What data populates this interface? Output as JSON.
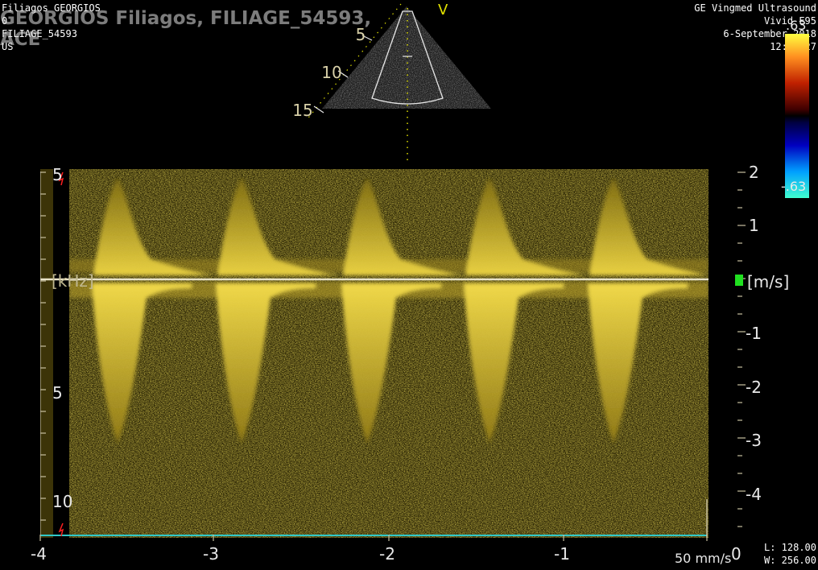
{
  "header_left": {
    "patient": "Filiagos GEORGIOS",
    "line2": "0",
    "id": "FILIAGE_54593",
    "modality": "US"
  },
  "overlay": {
    "name": "GEORGIOS  Filiagos, FILIAGE_54593,",
    "suffix": "ACE"
  },
  "header_right": {
    "vendor": "GE Vingmed Ultrasound",
    "model": "Vivid E95",
    "date": "6-September-2018",
    "time": "12:42:27"
  },
  "sector": {
    "depth_labels": [
      "5",
      "10",
      "15"
    ],
    "marker": "V"
  },
  "colorbar": {
    "top": ".63",
    "bottom": "-.63"
  },
  "left_axis": {
    "unit": "[kHz]",
    "labels": [
      "5",
      "5",
      "10"
    ]
  },
  "right_axis": {
    "unit": "[m/s]",
    "labels": [
      "2",
      "1",
      "-1",
      "-2",
      "-3",
      "-4"
    ]
  },
  "time_axis": {
    "labels": [
      "-4",
      "-3",
      "-2",
      "-1",
      "0"
    ],
    "sweep": "50 mm/s"
  },
  "window_level": {
    "L": "L: 128.00",
    "W": "W: 256.00"
  }
}
